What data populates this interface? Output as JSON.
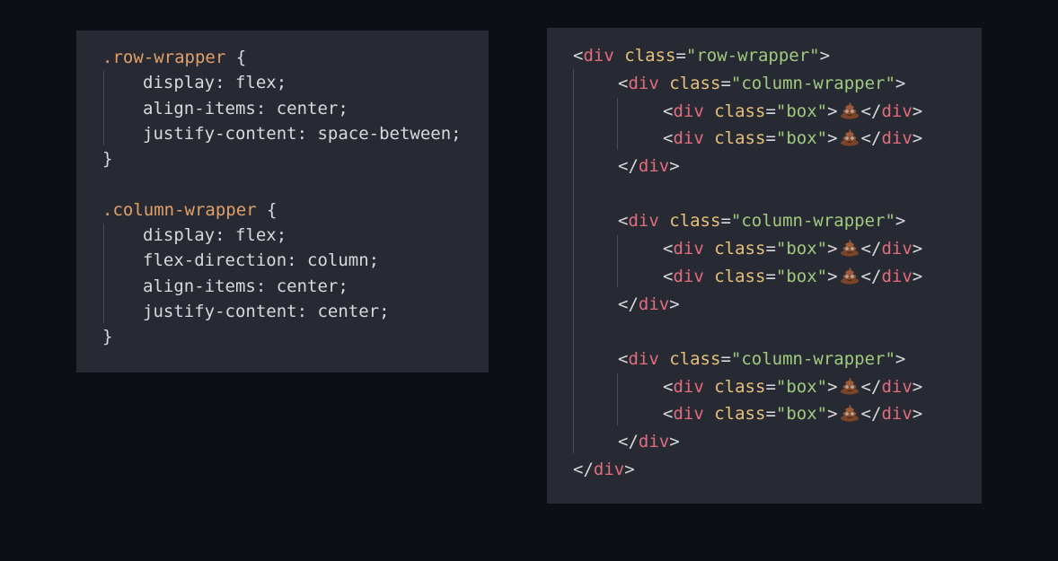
{
  "css_panel": {
    "rules": [
      {
        "selector": ".row-wrapper",
        "open": " {",
        "close": "}",
        "declarations": [
          "display: flex;",
          "align-items: center;",
          "justify-content: space-between;"
        ]
      },
      {
        "selector": ".column-wrapper",
        "open": " {",
        "close": "}",
        "declarations": [
          "display: flex;",
          "flex-direction: column;",
          "align-items: center;",
          "justify-content: center;"
        ]
      }
    ]
  },
  "html_panel": {
    "outer_open": {
      "lt": "<",
      "tag": "div",
      "attr": "class",
      "eq": "=",
      "value": "\"row-wrapper\"",
      "gt": ">"
    },
    "outer_close": {
      "lt": "</",
      "tag": "div",
      "gt": ">"
    },
    "groups": [
      {
        "open": {
          "lt": "<",
          "tag": "div",
          "attr": "class",
          "eq": "=",
          "value": "\"column-wrapper\"",
          "gt": ">"
        },
        "boxes": [
          {
            "lt": "<",
            "tag": "div",
            "attr": "class",
            "eq": "=",
            "value": "\"box\"",
            "gt": ">",
            "emoji": "pile-of-poo-icon",
            "close_lt": "</",
            "close_tag": "div",
            "close_gt": ">"
          },
          {
            "lt": "<",
            "tag": "div",
            "attr": "class",
            "eq": "=",
            "value": "\"box\"",
            "gt": ">",
            "emoji": "pile-of-poo-icon",
            "close_lt": "</",
            "close_tag": "div",
            "close_gt": ">"
          }
        ],
        "close": {
          "lt": "</",
          "tag": "div",
          "gt": ">"
        }
      },
      {
        "open": {
          "lt": "<",
          "tag": "div",
          "attr": "class",
          "eq": "=",
          "value": "\"column-wrapper\"",
          "gt": ">"
        },
        "boxes": [
          {
            "lt": "<",
            "tag": "div",
            "attr": "class",
            "eq": "=",
            "value": "\"box\"",
            "gt": ">",
            "emoji": "pile-of-poo-icon",
            "close_lt": "</",
            "close_tag": "div",
            "close_gt": ">"
          },
          {
            "lt": "<",
            "tag": "div",
            "attr": "class",
            "eq": "=",
            "value": "\"box\"",
            "gt": ">",
            "emoji": "pile-of-poo-icon",
            "close_lt": "</",
            "close_tag": "div",
            "close_gt": ">"
          }
        ],
        "close": {
          "lt": "</",
          "tag": "div",
          "gt": ">"
        }
      },
      {
        "open": {
          "lt": "<",
          "tag": "div",
          "attr": "class",
          "eq": "=",
          "value": "\"column-wrapper\"",
          "gt": ">"
        },
        "boxes": [
          {
            "lt": "<",
            "tag": "div",
            "attr": "class",
            "eq": "=",
            "value": "\"box\"",
            "gt": ">",
            "emoji": "pile-of-poo-icon",
            "close_lt": "</",
            "close_tag": "div",
            "close_gt": ">"
          },
          {
            "lt": "<",
            "tag": "div",
            "attr": "class",
            "eq": "=",
            "value": "\"box\"",
            "gt": ">",
            "emoji": "pile-of-poo-icon",
            "close_lt": "</",
            "close_tag": "div",
            "close_gt": ">"
          }
        ],
        "close": {
          "lt": "</",
          "tag": "div",
          "gt": ">"
        }
      }
    ]
  },
  "colors": {
    "background": "#0e0e17",
    "panel": "#282a33",
    "selector": "#dfa06a",
    "tag": "#e06d7d",
    "attribute": "#e5c07b",
    "string": "#9fca7f",
    "text": "#d7d9de"
  }
}
